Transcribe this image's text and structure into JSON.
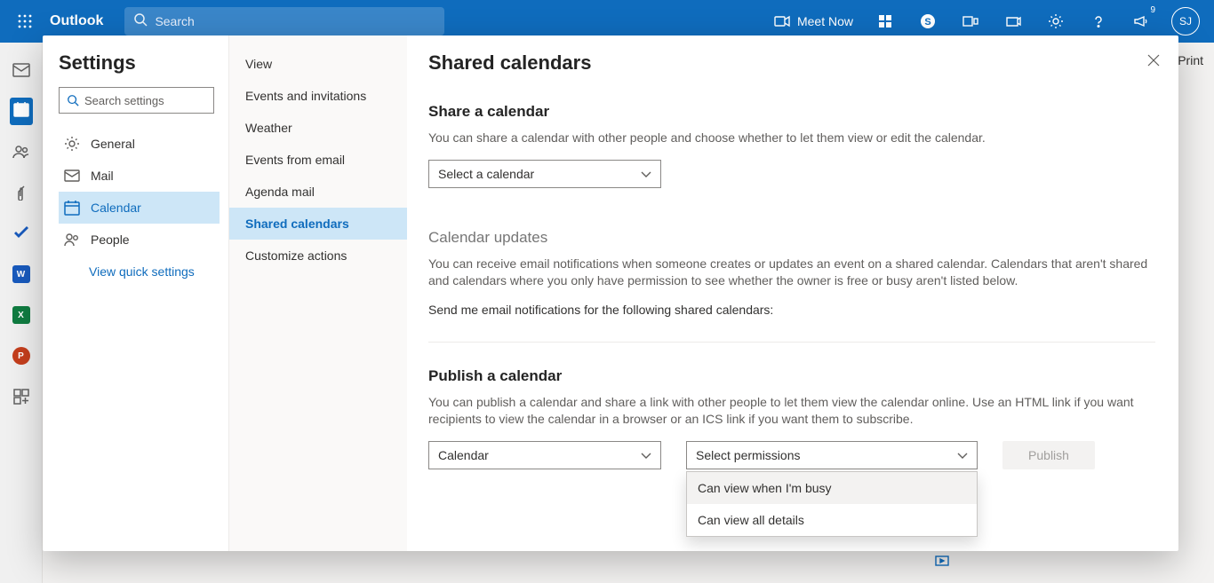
{
  "header": {
    "app": "Outlook",
    "search_placeholder": "Search",
    "meet_now": "Meet Now",
    "notification_count": "9",
    "avatar_initials": "SJ"
  },
  "print_label": "Print",
  "settings": {
    "title": "Settings",
    "search_placeholder": "Search settings",
    "nav1": [
      {
        "label": "General"
      },
      {
        "label": "Mail"
      },
      {
        "label": "Calendar"
      },
      {
        "label": "People"
      }
    ],
    "quick_settings": "View quick settings",
    "nav2": [
      {
        "label": "View"
      },
      {
        "label": "Events and invitations"
      },
      {
        "label": "Weather"
      },
      {
        "label": "Events from email"
      },
      {
        "label": "Agenda mail"
      },
      {
        "label": "Shared calendars"
      },
      {
        "label": "Customize actions"
      }
    ]
  },
  "panel": {
    "title": "Shared calendars",
    "share": {
      "heading": "Share a calendar",
      "desc": "You can share a calendar with other people and choose whether to let them view or edit the calendar.",
      "dropdown": "Select a calendar"
    },
    "updates": {
      "heading": "Calendar updates",
      "desc": "You can receive email notifications when someone creates or updates an event on a shared calendar. Calendars that aren't shared and calendars where you only have permission to see whether the owner is free or busy aren't listed below.",
      "prompt": "Send me email notifications for the following shared calendars:"
    },
    "publish": {
      "heading": "Publish a calendar",
      "desc": "You can publish a calendar and share a link with other people to let them view the calendar online. Use an HTML link if you want recipients to view the calendar in a browser or an ICS link if you want them to subscribe.",
      "calendar_dropdown": "Calendar",
      "permissions_dropdown": "Select permissions",
      "button": "Publish",
      "options": [
        "Can view when I'm busy",
        "Can view all details"
      ]
    }
  }
}
